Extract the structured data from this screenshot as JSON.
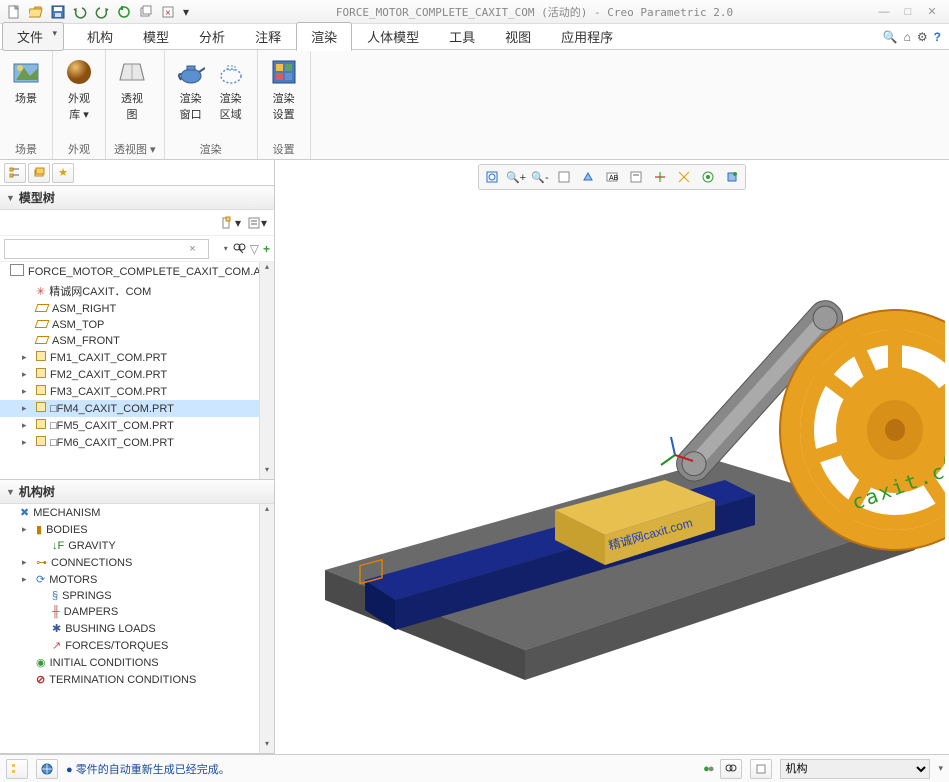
{
  "title": "FORCE_MOTOR_COMPLETE_CAXIT_COM (活动的) - Creo Parametric 2.0",
  "menu": {
    "file": "文件",
    "tabs": [
      "机构",
      "模型",
      "分析",
      "注释",
      "渲染",
      "人体模型",
      "工具",
      "视图",
      "应用程序"
    ],
    "active_index": 4
  },
  "ribbon": {
    "groups": [
      {
        "label": "场景",
        "items": [
          {
            "label": "场景",
            "icon": "scene"
          }
        ]
      },
      {
        "label": "外观",
        "items": [
          {
            "label": "外观\n库 ▾",
            "icon": "sphere"
          }
        ]
      },
      {
        "label": "透视图 ▾",
        "items": [
          {
            "label": "透视\n图",
            "icon": "perspective"
          }
        ]
      },
      {
        "label": "渲染",
        "items": [
          {
            "label": "渲染\n窗口",
            "icon": "teapot-blue"
          },
          {
            "label": "渲染\n区域",
            "icon": "teapot-outline"
          }
        ]
      },
      {
        "label": "设置",
        "items": [
          {
            "label": "渲染\n设置",
            "icon": "settings-tile"
          }
        ]
      }
    ]
  },
  "sidebar": {
    "model_tree_label": "模型树",
    "mechanism_tree_label": "机构树",
    "search_placeholder": "",
    "model_items": [
      {
        "label": "FORCE_MOTOR_COMPLETE_CAXIT_COM.ASM",
        "icon": "asm",
        "exp": ""
      },
      {
        "label": "精诚网CAXIT．COM",
        "icon": "coord",
        "exp": "",
        "indent": 1
      },
      {
        "label": "ASM_RIGHT",
        "icon": "plane",
        "exp": "",
        "indent": 1
      },
      {
        "label": "ASM_TOP",
        "icon": "plane",
        "exp": "",
        "indent": 1
      },
      {
        "label": "ASM_FRONT",
        "icon": "plane",
        "exp": "",
        "indent": 1
      },
      {
        "label": "FM1_CAXIT_COM.PRT",
        "icon": "prt",
        "exp": "▸",
        "indent": 1
      },
      {
        "label": "FM2_CAXIT_COM.PRT",
        "icon": "prt",
        "exp": "▸",
        "indent": 1
      },
      {
        "label": "FM3_CAXIT_COM.PRT",
        "icon": "prt",
        "exp": "▸",
        "indent": 1
      },
      {
        "label": "□FM4_CAXIT_COM.PRT",
        "icon": "prt",
        "exp": "▸",
        "indent": 1,
        "selected": true
      },
      {
        "label": "□FM5_CAXIT_COM.PRT",
        "icon": "prt",
        "exp": "▸",
        "indent": 1
      },
      {
        "label": "□FM6_CAXIT_COM.PRT",
        "icon": "prt",
        "exp": "▸",
        "indent": 1
      }
    ],
    "mech_items": [
      {
        "label": "MECHANISM",
        "icon": "mech",
        "exp": ""
      },
      {
        "label": "BODIES",
        "icon": "bodies",
        "exp": "▸",
        "indent": 1
      },
      {
        "label": "GRAVITY",
        "icon": "gravity",
        "exp": "",
        "indent": 2
      },
      {
        "label": "CONNECTIONS",
        "icon": "conn",
        "exp": "▸",
        "indent": 1
      },
      {
        "label": "MOTORS",
        "icon": "motors",
        "exp": "▸",
        "indent": 1
      },
      {
        "label": "SPRINGS",
        "icon": "springs",
        "exp": "",
        "indent": 2
      },
      {
        "label": "DAMPERS",
        "icon": "dampers",
        "exp": "",
        "indent": 2
      },
      {
        "label": "BUSHING LOADS",
        "icon": "bushing",
        "exp": "",
        "indent": 2
      },
      {
        "label": "FORCES/TORQUES",
        "icon": "forces",
        "exp": "",
        "indent": 2
      },
      {
        "label": "INITIAL CONDITIONS",
        "icon": "init",
        "exp": "",
        "indent": 1
      },
      {
        "label": "TERMINATION CONDITIONS",
        "icon": "term",
        "exp": "",
        "indent": 1
      }
    ]
  },
  "status": {
    "message": "● 零件的自动重新生成已经完成。",
    "selector": "机构",
    "traffic": "●●"
  },
  "watermark": "精诚网caxit.com"
}
